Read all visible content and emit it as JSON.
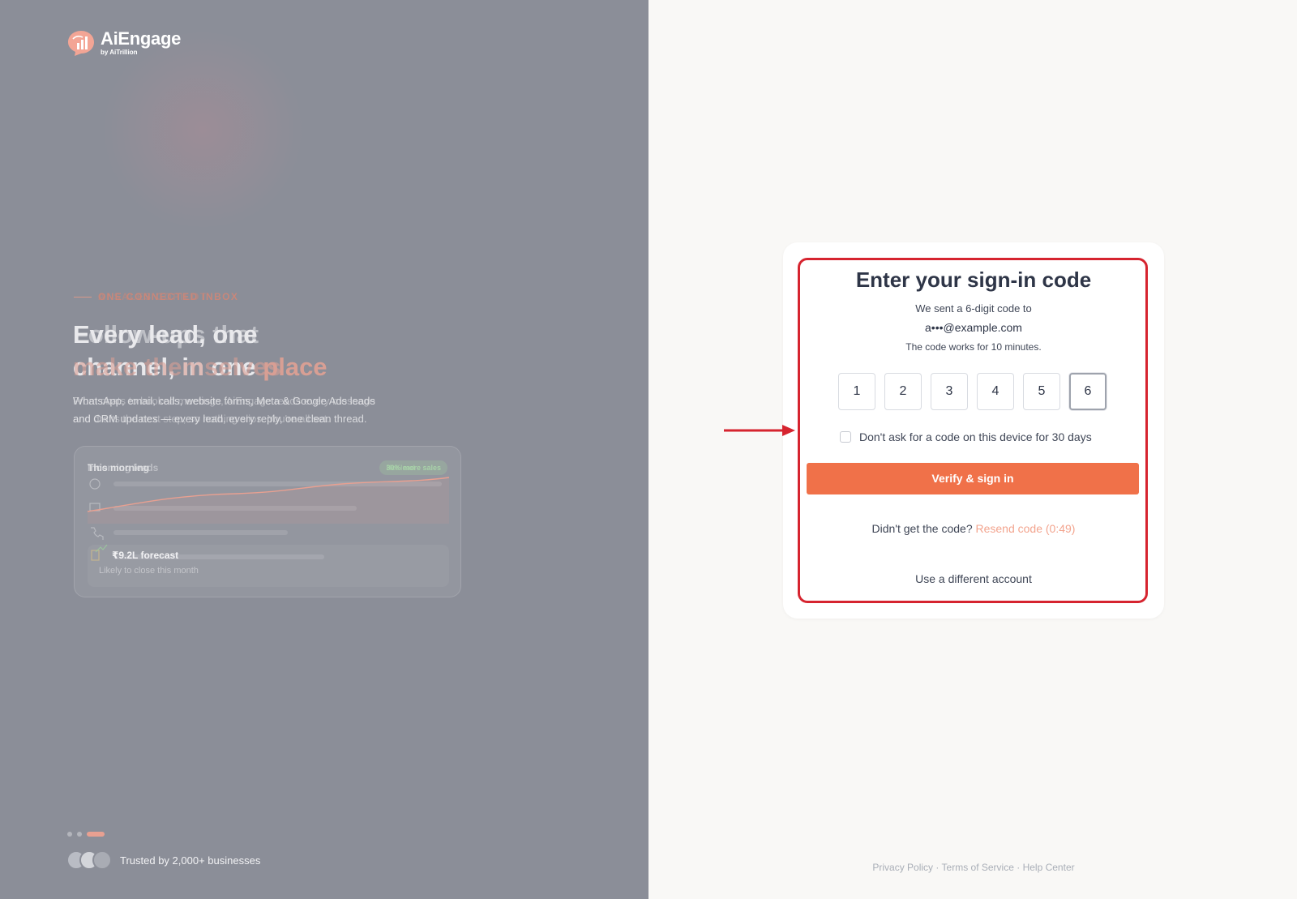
{
  "brand": {
    "name": "AiEngage",
    "by": "by AiTrillion"
  },
  "hero": {
    "eyebrow": "ONE CONNECTED INBOX",
    "eyebrow_ghost": "AI SALES COPILOT",
    "headline_line1": "Every lead, one",
    "headline_line1_ghost": "Follow-ups that",
    "headline_line2a": "channel, in one",
    "headline_line2b": "place",
    "headline_line2_ghost": "make themselves",
    "sub_line1": "WhatsApp, email, calls, website forms, Meta & Google Ads leads",
    "sub_line1_ghost": "From chats to booked meetings, AiEngage reads every message",
    "sub_line2": "and CRM updates — every lead, every reply, one clean thread.",
    "sub_line2_ghost": "and drafts the next step, so nothing slips. You're all set."
  },
  "card": {
    "title": "This morning",
    "title_ghost": "Incoming leads",
    "badge": "30% more sales",
    "badge_ghost": "Hot lead",
    "forecast_value": "₹9.2L forecast",
    "forecast_sub": "Likely to close this month",
    "accent_color": "#e8a091"
  },
  "carousel": {
    "total": 3,
    "active": 3
  },
  "trust": {
    "text": "Trusted by 2,000+ businesses"
  },
  "signin": {
    "title": "Enter your sign-in code",
    "sent_text": "We sent a 6-digit code to",
    "email": "a•••@example.com",
    "validity": "The code works for 10 minutes.",
    "code_digits": [
      "1",
      "2",
      "3",
      "4",
      "5",
      "6"
    ],
    "remember_label": "Don't ask for a code on this device for 30 days",
    "remember_checked": false,
    "verify_label": "Verify & sign in",
    "resend_prompt": "Didn't get the code?",
    "resend_link": "Resend code (0:49)",
    "different_account": "Use a different account",
    "primary_color": "#f07149",
    "highlight_color": "#d6242f"
  },
  "footer": {
    "privacy": "Privacy Policy",
    "terms": "Terms of Service",
    "help": "Help Center",
    "separator": "·"
  }
}
